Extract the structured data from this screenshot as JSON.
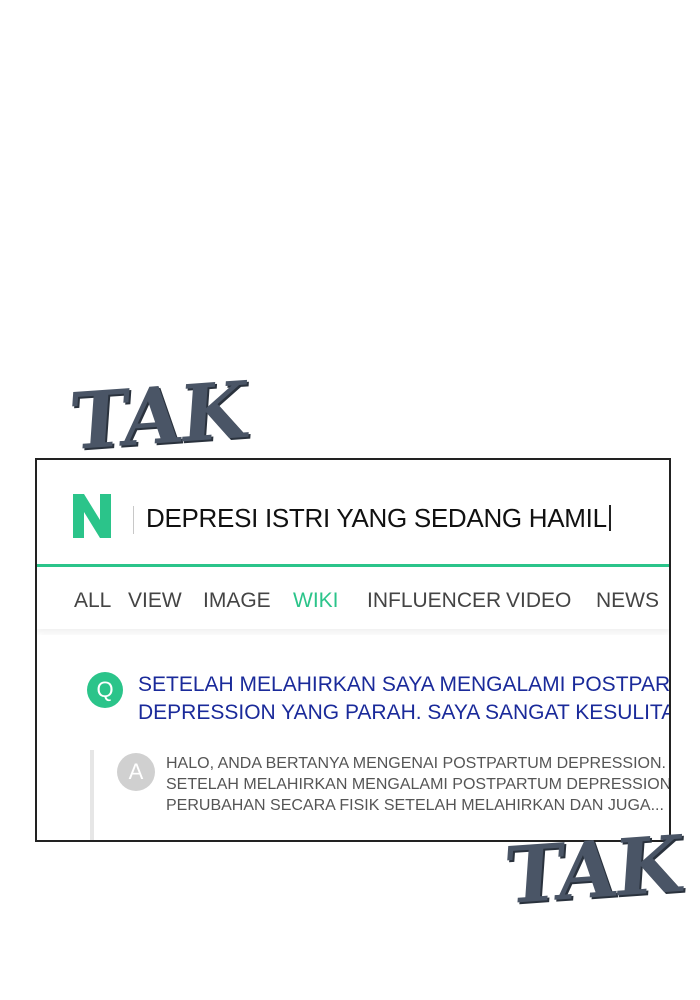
{
  "sfx": {
    "top": "TAK",
    "bottom": "TAK"
  },
  "search": {
    "logo_letter": "N",
    "query": "DEPRESI ISTRI YANG SEDANG HAMIL",
    "accent_color": "#2bc48a"
  },
  "tabs": [
    {
      "label": "ALL",
      "active": false
    },
    {
      "label": "VIEW",
      "active": false
    },
    {
      "label": "IMAGE",
      "active": false
    },
    {
      "label": "WIKI",
      "active": true
    },
    {
      "label": "INFLUENCER",
      "active": false
    },
    {
      "label": "VIDEO",
      "active": false
    },
    {
      "label": "NEWS",
      "active": false
    }
  ],
  "result": {
    "q_badge": "Q",
    "question_lines": [
      "SETELAH MELAHIRKAN SAYA MENGALAMI POSTPARTUM",
      "DEPRESSION YANG PARAH. SAYA SANGAT KESULITAN"
    ],
    "a_badge": "A",
    "answer_lines": [
      "HALO, ANDA BERTANYA MENGENAI POSTPARTUM DEPRESSION.",
      "SETELAH MELAHIRKAN MENGALAMI POSTPARTUM DEPRESSION",
      "PERUBAHAN SECARA FISIK SETELAH MELAHIRKAN DAN JUGA..."
    ]
  }
}
